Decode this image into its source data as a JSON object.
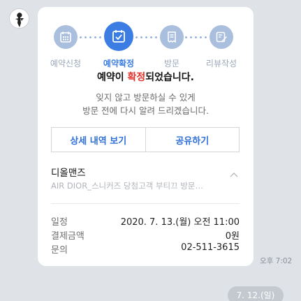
{
  "steps": [
    {
      "label": "예약신청",
      "icon": "calendar-grid-icon"
    },
    {
      "label": "예약확정",
      "icon": "calendar-check-icon"
    },
    {
      "label": "방문",
      "icon": "receipt-icon"
    },
    {
      "label": "리뷰작성",
      "icon": "pencil-note-icon"
    }
  ],
  "message": {
    "title_before": "예약이 ",
    "title_highlight": "확정",
    "title_after": "되었습니다.",
    "line1": "잊지 않고 방문하실 수 있게",
    "line2": "방문 전에 다시 알려 드리겠습니다."
  },
  "buttons": {
    "details": "상세 내역 보기",
    "share": "공유하기"
  },
  "store": {
    "name": "디올맨즈",
    "description": "AIR DIOR_스니커즈 당첨고객 부티끄 방문…"
  },
  "info": {
    "date_label": "일정",
    "date_value": "2020. 7. 13.(월) 오전 11:00",
    "payment_label": "결제금액",
    "payment_value": "0원",
    "contact_label": "문의",
    "contact_value": "02-511-3615"
  },
  "timestamp": "오후 7:02",
  "date_separator": "7. 12.(일)",
  "colors": {
    "accent": "#3b7de2",
    "highlight": "#e0322a",
    "inactive_step": "#a9bfdd"
  }
}
